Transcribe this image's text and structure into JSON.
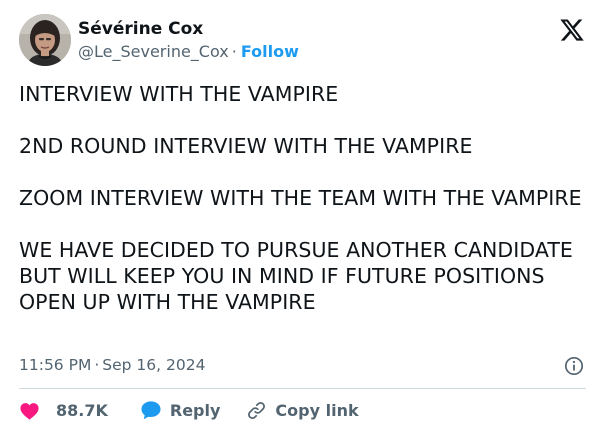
{
  "author": {
    "display_name": "Sévérine Cox",
    "handle": "@Le_Severine_Cox",
    "separator": "·",
    "follow_label": "Follow"
  },
  "tweet": {
    "paragraphs": [
      "INTERVIEW WITH THE VAMPIRE",
      "2ND ROUND INTERVIEW WITH THE VAMPIRE",
      "ZOOM INTERVIEW WITH THE TEAM WITH THE VAMPIRE",
      "WE HAVE DECIDED TO PURSUE ANOTHER CANDIDATE BUT WILL KEEP YOU IN MIND IF FUTURE POSITIONS OPEN UP WITH THE VAMPIRE"
    ],
    "time": "11:56 PM",
    "date_separator": "·",
    "date": "Sep 16, 2024"
  },
  "actions": {
    "like_count": "88.7K",
    "reply_label": "Reply",
    "copy_link_label": "Copy link"
  },
  "icons": {
    "brand": "x-logo-icon",
    "info": "info-icon",
    "like": "heart-icon",
    "reply": "reply-bubble-icon",
    "copy_link": "link-icon"
  },
  "colors": {
    "text": "#0f1419",
    "secondary_text": "#536471",
    "follow": "#1d9bf0",
    "like": "#f91880",
    "reply": "#1d9bf0",
    "divider": "#cfd9de"
  }
}
